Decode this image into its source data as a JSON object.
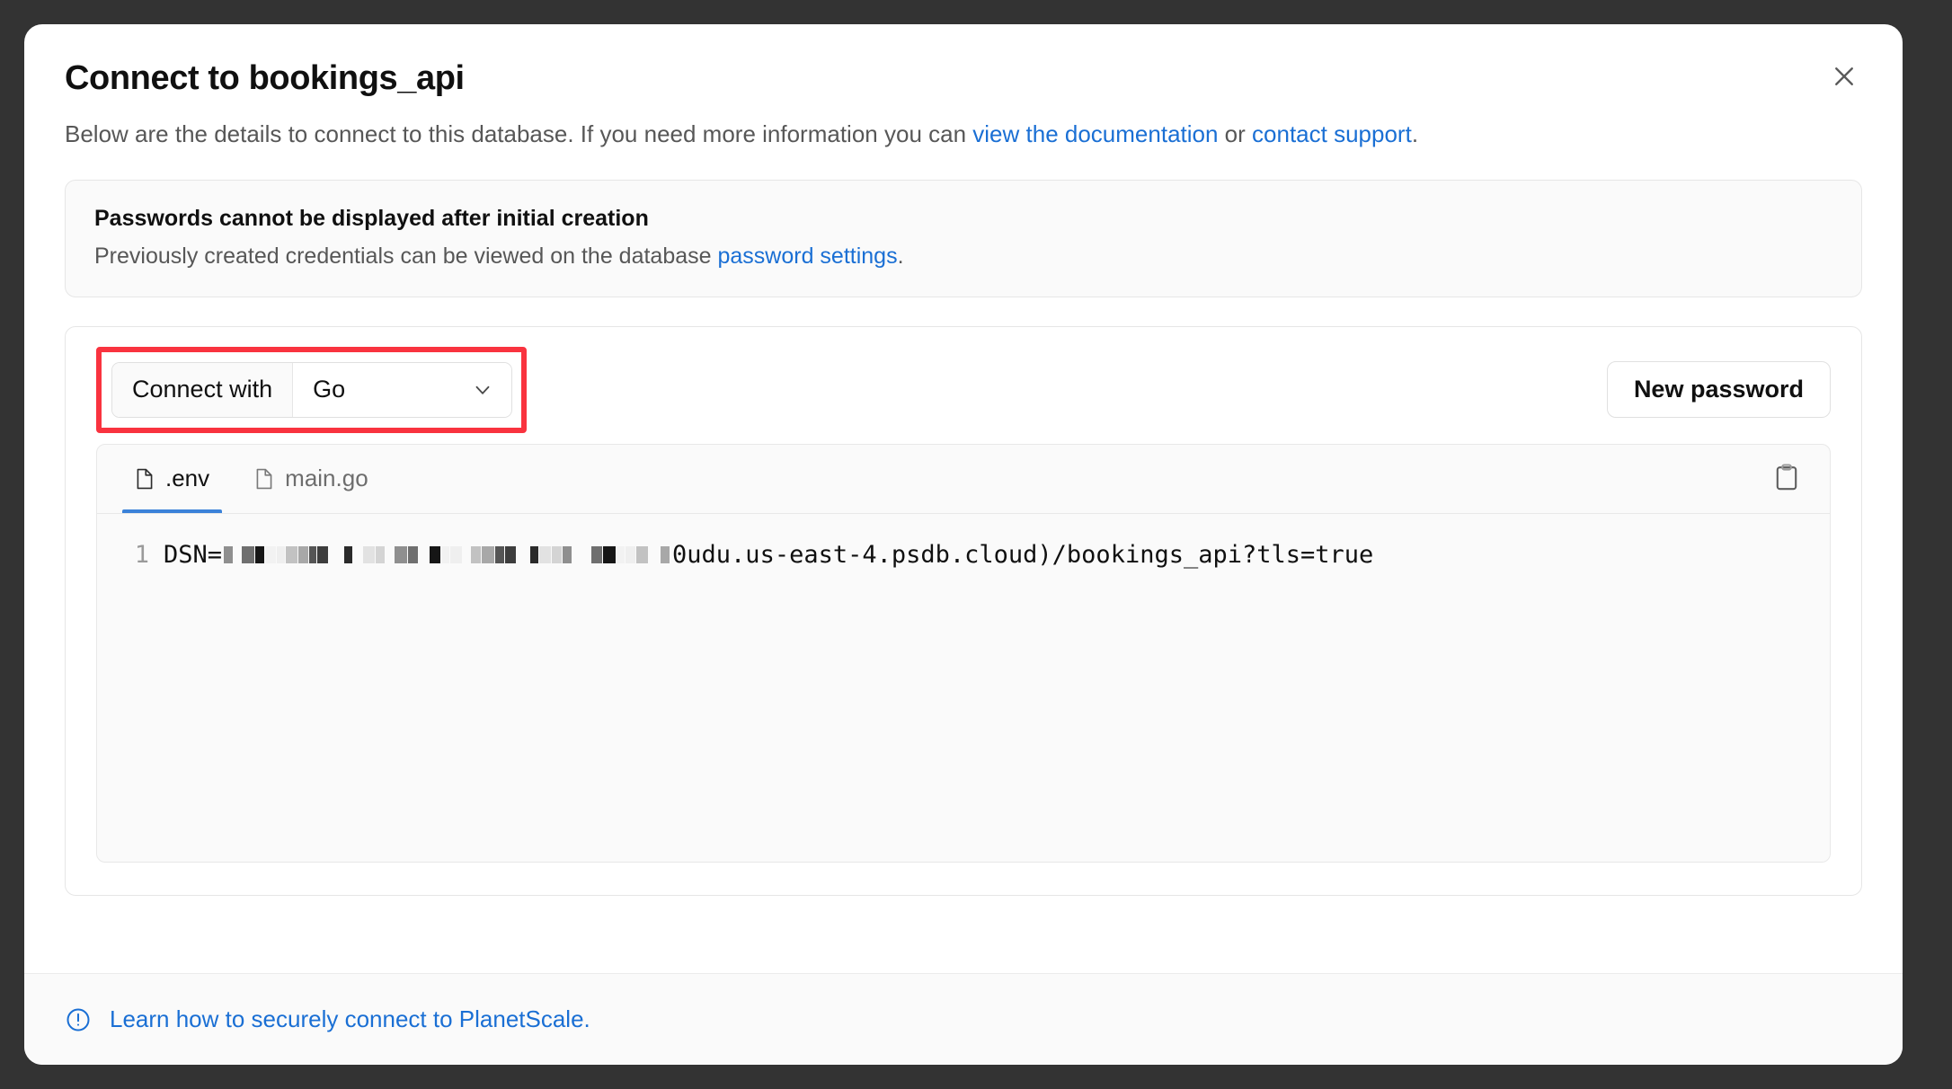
{
  "modal": {
    "title": "Connect to bookings_api",
    "subtitle": {
      "part1": "Below are the details to connect to this database. If you need more information you can ",
      "link1": "view the documentation",
      "part2": " or ",
      "link2": "contact support",
      "part3": "."
    },
    "close_icon": "close-icon"
  },
  "notice": {
    "title": "Passwords cannot be displayed after initial creation",
    "text_before": "Previously created credentials can be viewed on the database ",
    "link": "password settings",
    "text_after": "."
  },
  "connect": {
    "connect_with_label": "Connect with",
    "selected_language": "Go",
    "language_options": [
      "Go"
    ],
    "new_password_label": "New password",
    "highlight_color": "#f9333f"
  },
  "code_panel": {
    "tabs": [
      {
        "label": ".env",
        "active": true,
        "icon": "file-icon"
      },
      {
        "label": "main.go",
        "active": false,
        "icon": "file-icon"
      }
    ],
    "copy_icon": "clipboard-icon",
    "line_number": "1",
    "code_prefix": "DSN=",
    "code_suffix": "0udu.us-east-4.psdb.cloud)/bookings_api?tls=true",
    "redacted": true
  },
  "footer": {
    "icon": "exclamation-circle-icon",
    "link": "Learn how to securely connect to PlanetScale."
  },
  "colors": {
    "link": "#1a6fd4",
    "accent_tab": "#3b82d9",
    "highlight": "#f9333f",
    "backdrop": "#333333"
  }
}
